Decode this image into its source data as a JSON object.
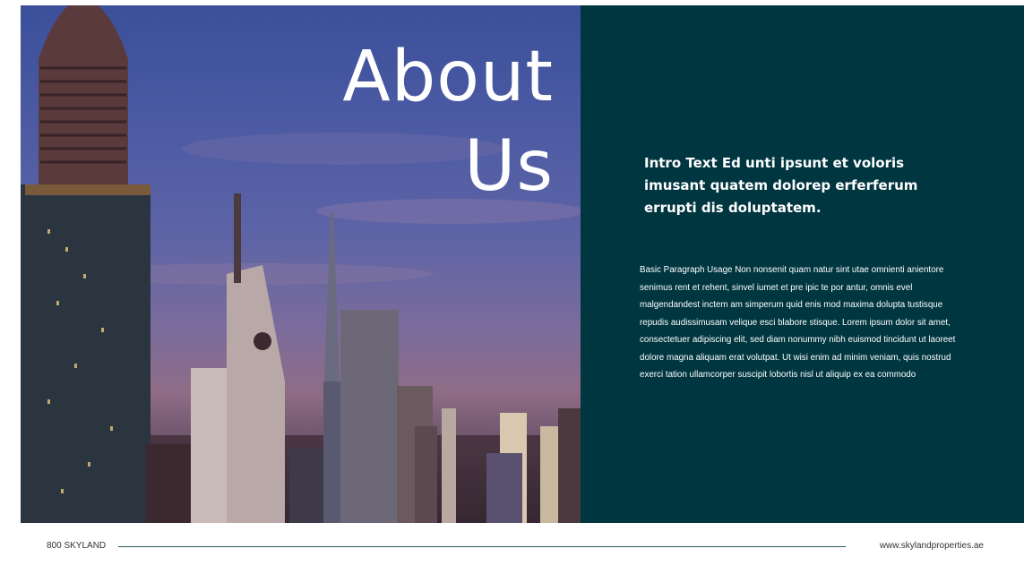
{
  "slide": {
    "title_line1": "About",
    "title_line2": "Us",
    "intro": "Intro Text Ed unti ipsunt et voloris imusant quatem dolorep erferferum errupti dis doluptatem.",
    "paragraph": "Basic Paragraph Usage Non nonsenit quam natur sint utae omnienti anientore senimus rent et rehent, sinvel iumet et pre ipic te por antur, omnis evel malgendandest inctem am simperum quid enis mod maxima dolupta tustisque repudis audissimusam velique esci blabore stisque. Lorem ipsum dolor sit amet, consectetuer adipiscing elit, sed diam nonummy nibh euismod tincidunt ut laoreet dolore magna aliquam erat volutpat. Ut wisi enim ad minim veniam, quis nostrud exerci tation ullamcorper suscipit lobortis nisl ut aliquip ex ea commodo"
  },
  "footer": {
    "left": "800 SKYLAND",
    "right": "www.skylandproperties.ae"
  },
  "colors": {
    "panel": "#003640",
    "text": "#ffffff",
    "footer_text": "#333333"
  }
}
